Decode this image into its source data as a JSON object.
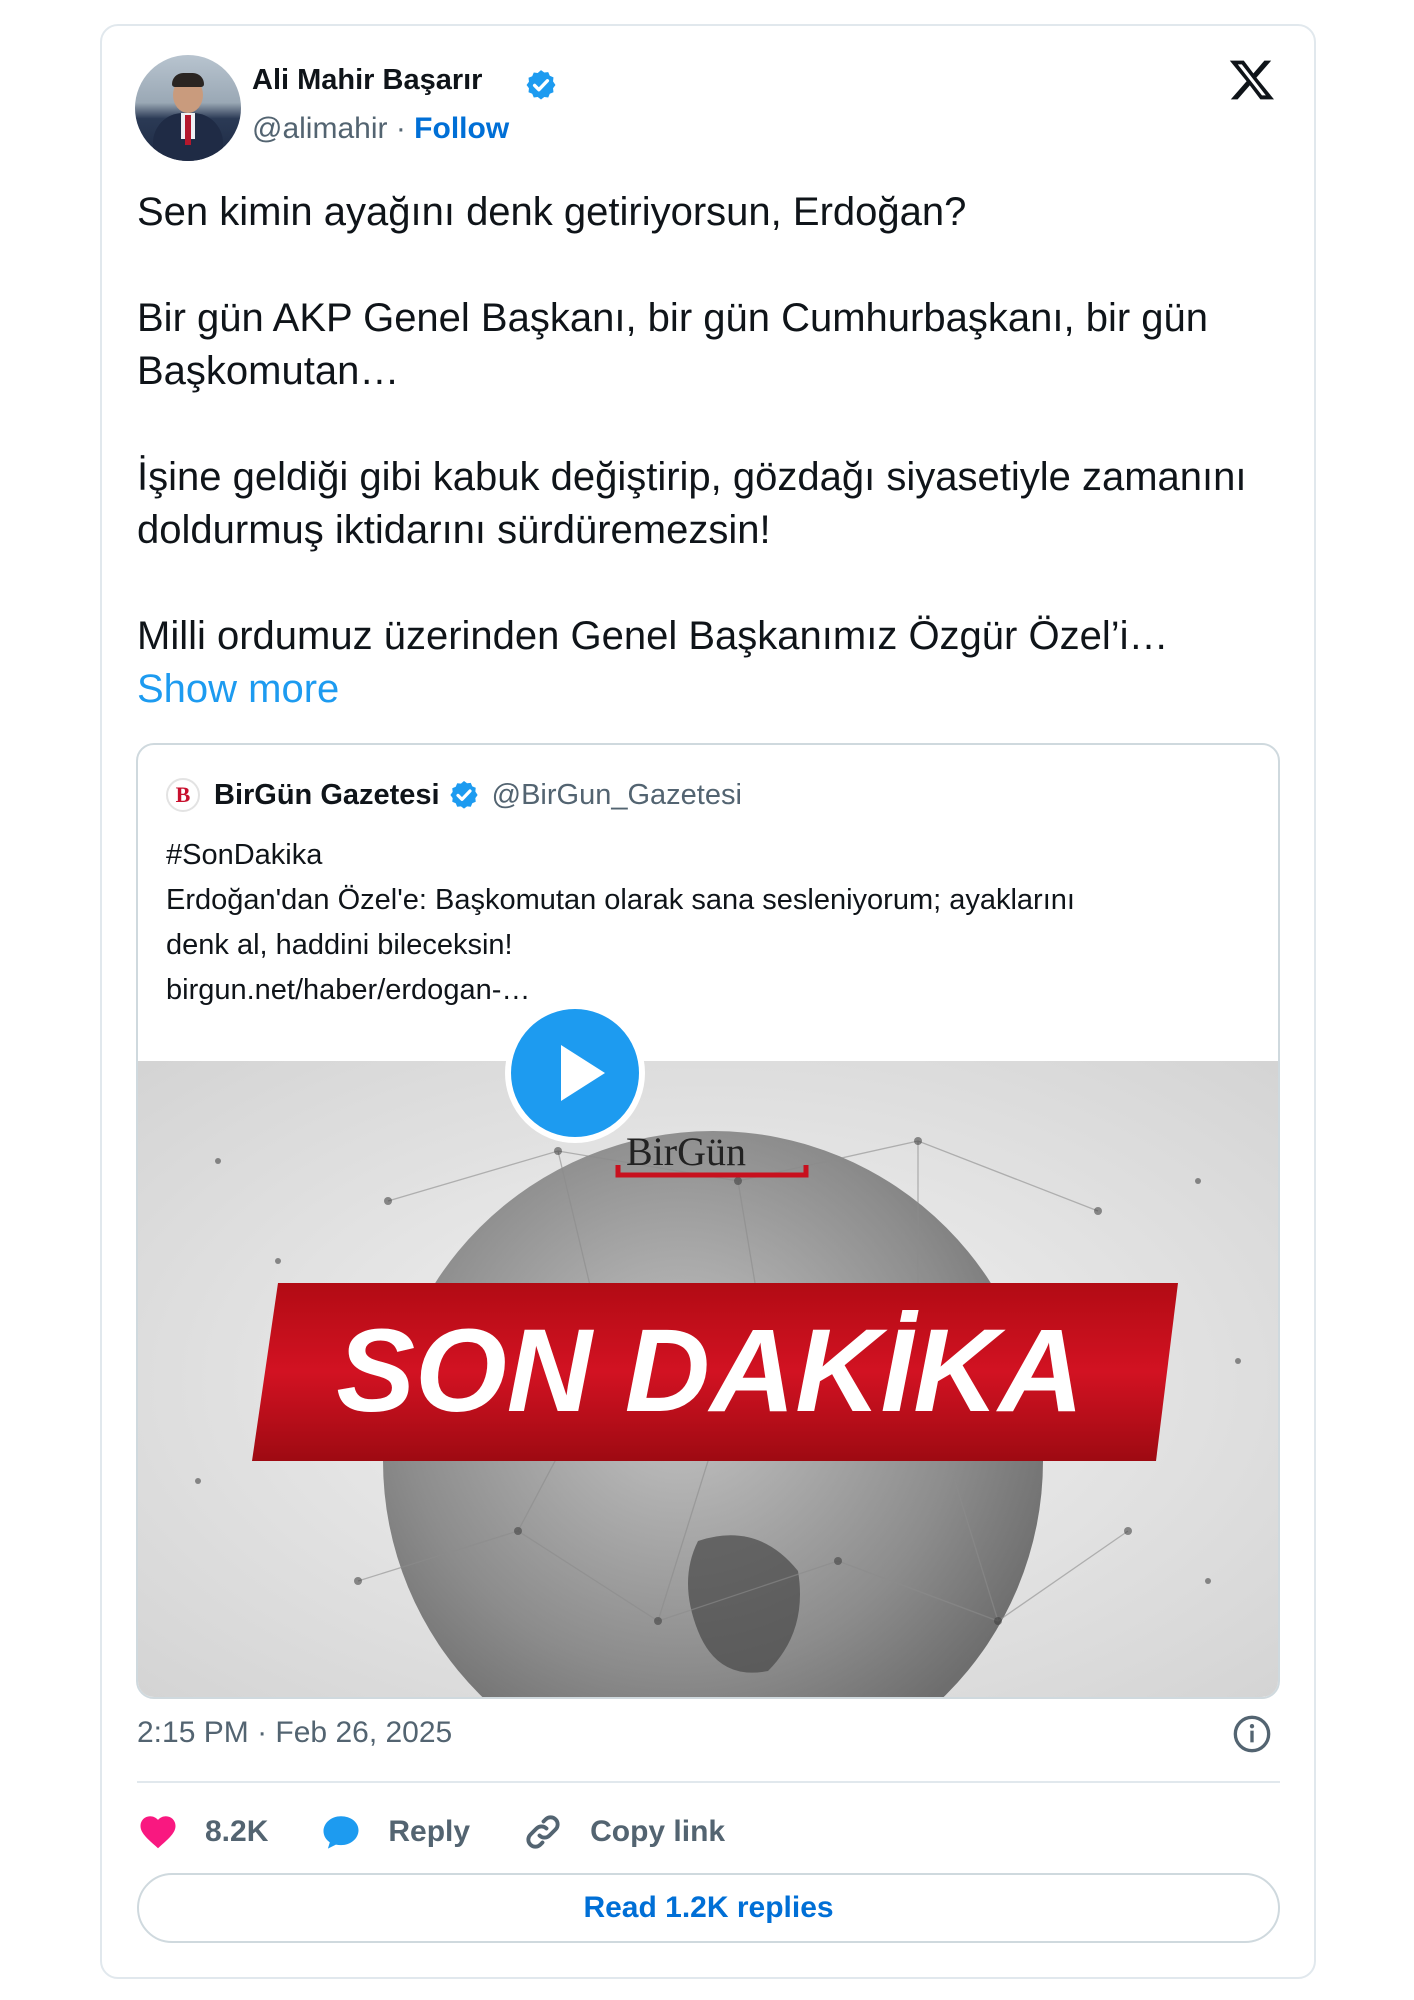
{
  "author": {
    "name": "Ali Mahir Başarır",
    "handle": "@alimahir",
    "separator": "·",
    "follow_label": "Follow"
  },
  "tweet": {
    "paragraphs": [
      "Sen kimin ayağını denk getiriyorsun, Erdoğan?",
      "Bir gün AKP Genel Başkanı, bir gün Cumhurbaşkanı, bir gün Başkomutan…",
      "İşine geldiği gibi kabuk değiştirip, gözdağı siyasetiyle zamanını doldurmuş iktidarını sürdüremezsin!"
    ],
    "last_paragraph": "Milli ordumuz üzerinden Genel Başkanımız Özgür Özel’i…",
    "show_more_label": "Show more"
  },
  "quote": {
    "logo_letter": "B",
    "name": "BirGün Gazetesi",
    "handle": "@BirGun_Gazetesi",
    "lines": [
      "#SonDakika",
      "Erdoğan'dan Özel'e: Başkomutan olarak sana sesleniyorum; ayaklarını",
      "denk al, haddini bileceksin!",
      "birgun.net/haber/erdogan-…"
    ],
    "media": {
      "brand_text_1": "BirGün",
      "banner_text": "SON DAKİKA"
    }
  },
  "meta": {
    "time": "2:15 PM",
    "separator": "·",
    "date": "Feb 26, 2025"
  },
  "actions": {
    "likes": "8.2K",
    "reply_label": "Reply",
    "copy_link_label": "Copy link"
  },
  "read_replies_label": "Read 1.2K replies",
  "colors": {
    "accent": "#1d9bf0",
    "link": "#006fd6",
    "like": "#f91880",
    "banner_red": "#c8101e"
  },
  "icons": [
    "verified-badge-icon",
    "x-logo-icon",
    "play-icon",
    "info-icon",
    "heart-icon",
    "reply-icon",
    "link-icon"
  ]
}
